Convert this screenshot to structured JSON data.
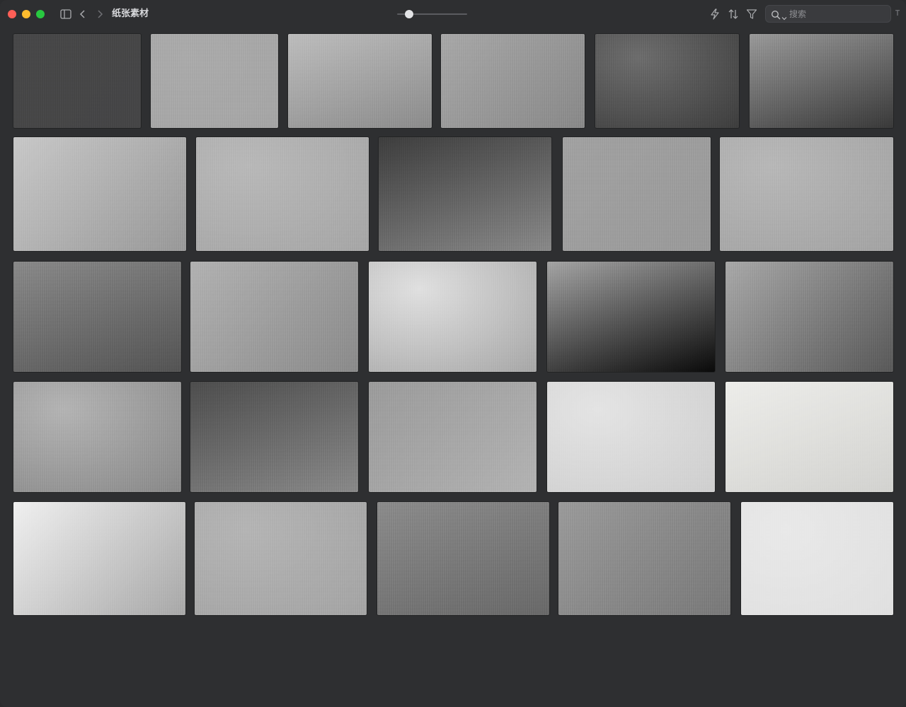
{
  "window": {
    "title": "纸张素材"
  },
  "toolbar": {
    "icons": [
      "sidebar-toggle-icon",
      "chevron-left-icon",
      "chevron-right-icon",
      "bolt-icon",
      "sort-icon",
      "filter-icon",
      "search-icon",
      "chevron-down-icon",
      "pin-icon"
    ],
    "zoom_level": 0.12
  },
  "search": {
    "placeholder": "搜索",
    "value": ""
  },
  "colors": {
    "window_bg": "#2e2f31",
    "text": "#d8d9dc",
    "icon": "#a9aaad"
  },
  "gallery": {
    "tiles": [
      {
        "row": 1,
        "col": 1,
        "tone": "#484849",
        "tone2": "#464647"
      },
      {
        "row": 1,
        "col": 2,
        "tone": "#ababab",
        "tone2": "#a6a6a6"
      },
      {
        "row": 1,
        "col": 3,
        "tone": "#bdbdbd",
        "tone2": "#8d8d8d"
      },
      {
        "row": 1,
        "col": 4,
        "tone": "#a8a8a8",
        "tone2": "#8a8a8a"
      },
      {
        "row": 1,
        "col": 5,
        "tone": "#6e6e6e",
        "tone2": "#3e3e3e"
      },
      {
        "row": 1,
        "col": 6,
        "tone": "#9a9a9a",
        "tone2": "#3a3a3a"
      },
      {
        "row": 2,
        "col": 1,
        "tone": "#c8c8c8",
        "tone2": "#9a9a9a"
      },
      {
        "row": 2,
        "col": 2,
        "tone": "#b9b9b9",
        "tone2": "#a7a7a7"
      },
      {
        "row": 2,
        "col": 3,
        "tone": "#3e3e3e",
        "tone2": "#8a8a8a"
      },
      {
        "row": 2,
        "col": 4,
        "tone": "#a2a2a2",
        "tone2": "#9b9b9b"
      },
      {
        "row": 2,
        "col": 5,
        "tone": "#b8b8b8",
        "tone2": "#a4a4a4"
      },
      {
        "row": 3,
        "col": 1,
        "tone": "#8a8a8a",
        "tone2": "#555555"
      },
      {
        "row": 3,
        "col": 2,
        "tone": "#b2b2b2",
        "tone2": "#8c8c8c"
      },
      {
        "row": 3,
        "col": 3,
        "tone": "#e0e0e0",
        "tone2": "#a8a8a8"
      },
      {
        "row": 3,
        "col": 4,
        "tone": "#a5a5a5",
        "tone2": "#0a0a0a"
      },
      {
        "row": 3,
        "col": 5,
        "tone": "#a9a9a9",
        "tone2": "#5a5a5a"
      },
      {
        "row": 4,
        "col": 1,
        "tone": "#b4b4b4",
        "tone2": "#8a8a8a"
      },
      {
        "row": 4,
        "col": 2,
        "tone": "#4e4e4e",
        "tone2": "#8a8a8a"
      },
      {
        "row": 4,
        "col": 3,
        "tone": "#9c9c9c",
        "tone2": "#b3b3b3"
      },
      {
        "row": 4,
        "col": 4,
        "tone": "#e4e4e4",
        "tone2": "#cfcfcf"
      },
      {
        "row": 4,
        "col": 5,
        "tone": "#ededea",
        "tone2": "#d3d3d0"
      },
      {
        "row": 5,
        "col": 1,
        "tone": "#f0f0f0",
        "tone2": "#a9a9a9"
      },
      {
        "row": 5,
        "col": 2,
        "tone": "#b5b5b5",
        "tone2": "#a5a5a5"
      },
      {
        "row": 5,
        "col": 3,
        "tone": "#8c8c8c",
        "tone2": "#6a6a6a"
      },
      {
        "row": 5,
        "col": 4,
        "tone": "#9b9b9b",
        "tone2": "#7a7a7a"
      },
      {
        "row": 5,
        "col": 5,
        "tone": "#e9e9e9",
        "tone2": "#e0e0e0"
      }
    ]
  }
}
